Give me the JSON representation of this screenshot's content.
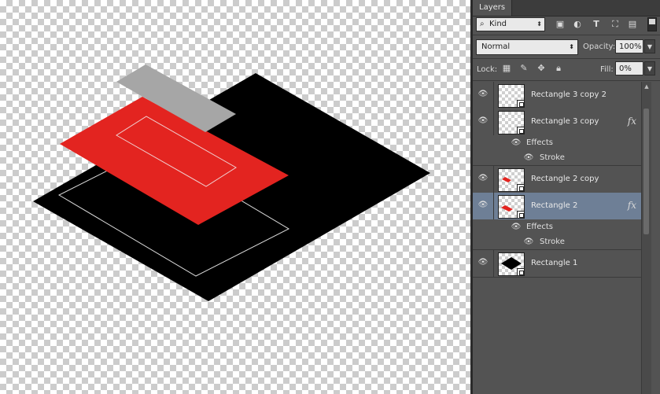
{
  "panel": {
    "tab_title": "Layers",
    "filter": {
      "kind_label": "Kind",
      "icons": [
        "image-filter-icon",
        "adjustment-filter-icon",
        "type-filter-icon",
        "shape-filter-icon",
        "smart-object-filter-icon"
      ]
    },
    "blend_mode": "Normal",
    "opacity_label": "Opacity:",
    "opacity_value": "100%",
    "lock_label": "Lock:",
    "fill_label": "Fill:",
    "fill_value": "0%",
    "layers": [
      {
        "name": "Rectangle 3 copy 2",
        "thumb": "empty",
        "fx": false,
        "selected": false
      },
      {
        "name": "Rectangle 3 copy",
        "thumb": "empty",
        "fx": true,
        "selected": false
      },
      {
        "name": "Rectangle 2 copy",
        "thumb": "red",
        "fx": false,
        "selected": false
      },
      {
        "name": "Rectangle 2",
        "thumb": "red",
        "fx": true,
        "selected": true
      },
      {
        "name": "Rectangle 1",
        "thumb": "black",
        "fx": false,
        "selected": false
      }
    ],
    "effects_label": "Effects",
    "stroke_label": "Stroke",
    "fx_label": "fx"
  },
  "colors": {
    "panel_bg": "#535353",
    "selected_row": "#6e7f96",
    "shape_black": "#000000",
    "shape_red": "#e32420",
    "shape_gray": "#a6a6a6"
  }
}
